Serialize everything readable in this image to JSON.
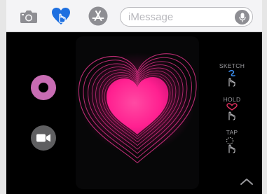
{
  "toolbar": {
    "icons": [
      "camera-icon",
      "digital-touch-icon",
      "app-store-icon"
    ],
    "message_placeholder": "iMessage",
    "mic_icon": "microphone-icon"
  },
  "controls": {
    "color_button_color": "#c86cb3",
    "video_icon": "video-camera-icon"
  },
  "drawing": {
    "shape": "heart",
    "color": "#ff1f8e"
  },
  "hints": [
    {
      "label": "SKETCH",
      "icon": "sketch-gesture-icon",
      "icon_color": "#3b8ef0"
    },
    {
      "label": "HOLD",
      "icon": "hold-gesture-icon",
      "icon_color": "#e0305f"
    },
    {
      "label": "TAP",
      "icon": "tap-gesture-icon",
      "icon_color": "#cccccc"
    }
  ],
  "expand_icon": "chevron-up-icon"
}
